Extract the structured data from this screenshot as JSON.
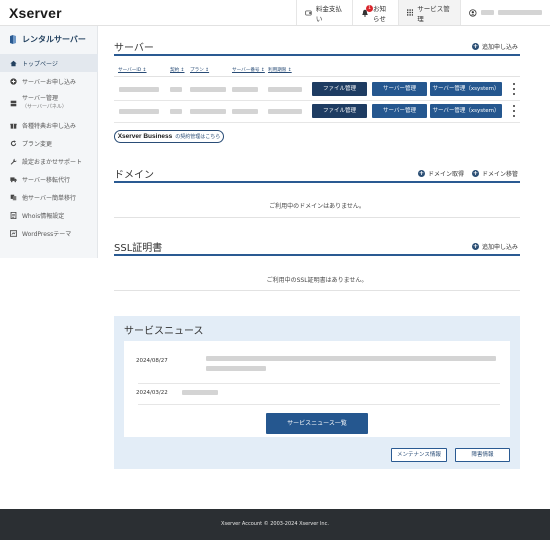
{
  "header": {
    "logo": "Xserver",
    "pay_label": "料金支払い",
    "notice_label": "お知らせ",
    "notice_count": "1",
    "service_label": "サービス管理"
  },
  "sidebar": {
    "title": "レンタルサーバー",
    "items": [
      {
        "label": "トップページ",
        "icon": "home-icon",
        "active": true
      },
      {
        "label": "サーバーお申し込み",
        "icon": "plus-circle-icon"
      },
      {
        "label": "サーバー管理",
        "sub": "（サーバーパネル）",
        "icon": "server-icon"
      },
      {
        "label": "各種特典お申し込み",
        "icon": "gift-icon"
      },
      {
        "label": "プラン変更",
        "icon": "refresh-icon"
      },
      {
        "label": "設定おまかせサポート",
        "icon": "wrench-icon"
      },
      {
        "label": "サーバー移転代行",
        "icon": "truck-icon"
      },
      {
        "label": "他サーバー簡単移行",
        "icon": "transfer-icon"
      },
      {
        "label": "Whois情報設定",
        "icon": "document-icon"
      },
      {
        "label": "WordPressテーマ",
        "icon": "theme-icon"
      }
    ]
  },
  "server": {
    "title": "サーバー",
    "add_label": "追加申し込み",
    "columns": [
      "サーバーID ↕",
      "契約 ↕",
      "プラン ↕",
      "サーバー番号 ↕",
      "利用期限 ↕"
    ],
    "file_btn": "ファイル管理",
    "server_btn": "サーバー管理",
    "xsystem_btn": "サーバー管理（xsystem）",
    "business_brand": "Xserver Business",
    "business_text": "の契約管理はこちら"
  },
  "domain": {
    "title": "ドメイン",
    "acquire_label": "ドメイン取得",
    "transfer_label": "ドメイン移管",
    "empty": "ご利用中のドメインはありません。"
  },
  "ssl": {
    "title": "SSL証明書",
    "add_label": "追加申し込み",
    "empty": "ご利用中のSSL証明書はありません。"
  },
  "news": {
    "title": "サービスニュース",
    "items": [
      {
        "date": "2024/08/27"
      },
      {
        "date": "2024/03/22"
      }
    ],
    "list_btn": "サービスニュース一覧",
    "maintenance_btn": "メンテナンス情報",
    "trouble_btn": "障害情報"
  },
  "footer": {
    "copyright": "Xserver Account © 2003-2024 Xserver Inc."
  }
}
